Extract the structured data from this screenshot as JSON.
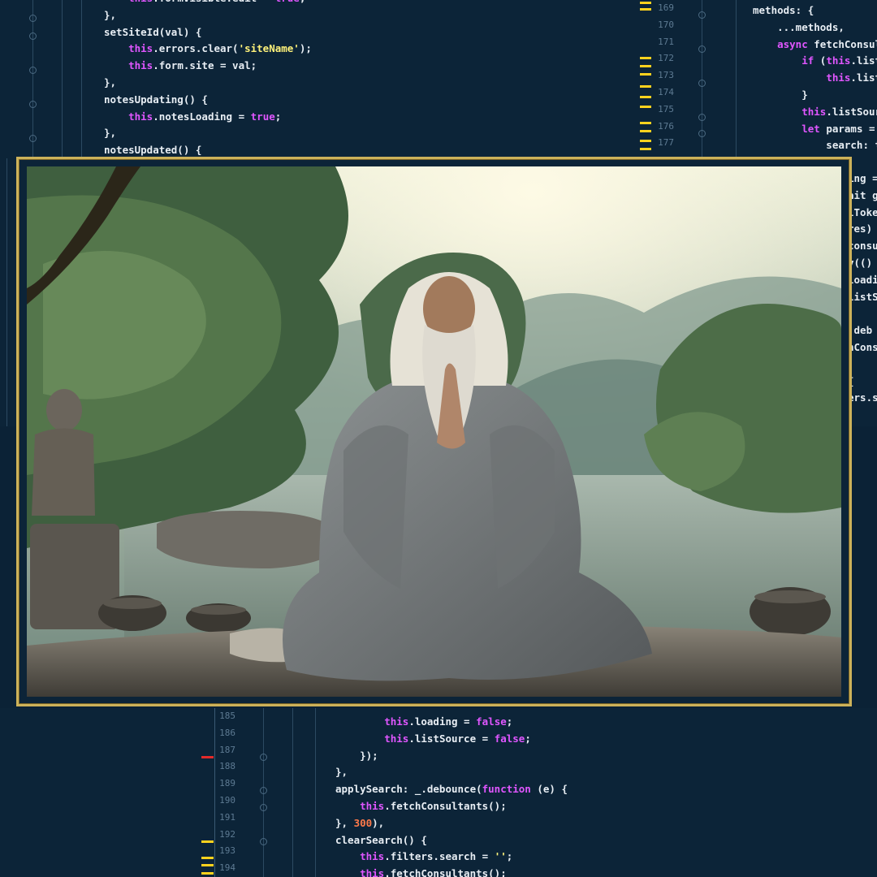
{
  "editor_top_left": {
    "lines": [
      [
        {
          "t": "    "
        },
        {
          "t": "this",
          "c": "kw"
        },
        {
          "t": ".formVisible.edit = "
        },
        {
          "t": "true",
          "c": "kw"
        },
        {
          "t": ";"
        }
      ],
      [
        {
          "t": "},"
        }
      ],
      [
        {
          "t": "setSiteId(val) {"
        }
      ],
      [
        {
          "t": "    "
        },
        {
          "t": "this",
          "c": "kw"
        },
        {
          "t": ".errors.clear("
        },
        {
          "t": "'siteName'",
          "c": "str"
        },
        {
          "t": ");"
        }
      ],
      [
        {
          "t": "    "
        },
        {
          "t": "this",
          "c": "kw"
        },
        {
          "t": ".form.site = val;"
        }
      ],
      [
        {
          "t": "},"
        }
      ],
      [
        {
          "t": "notesUpdating() {"
        }
      ],
      [
        {
          "t": "    "
        },
        {
          "t": "this",
          "c": "kw"
        },
        {
          "t": ".notesLoading = "
        },
        {
          "t": "true",
          "c": "kw"
        },
        {
          "t": ";"
        }
      ],
      [
        {
          "t": "},"
        }
      ],
      [
        {
          "t": "notesUpdated() {"
        }
      ]
    ]
  },
  "editor_top_right": {
    "line_numbers": [
      "169",
      "170",
      "171",
      "172",
      "173",
      "174",
      "175",
      "176",
      "177"
    ],
    "lines": [
      [
        {
          "t": "methods: {"
        }
      ],
      [
        {
          "t": "    ...methods,"
        }
      ],
      [
        {
          "t": "    "
        },
        {
          "t": "async",
          "c": "kw"
        },
        {
          "t": " fetchConsult"
        }
      ],
      [
        {
          "t": "        "
        },
        {
          "t": "if",
          "c": "kw"
        },
        {
          "t": " ("
        },
        {
          "t": "this",
          "c": "kw"
        },
        {
          "t": ".listS"
        }
      ],
      [
        {
          "t": "            "
        },
        {
          "t": "this",
          "c": "kw"
        },
        {
          "t": ".listS"
        }
      ],
      [
        {
          "t": "        }"
        }
      ],
      [
        {
          "t": "        "
        },
        {
          "t": "this",
          "c": "kw"
        },
        {
          "t": ".listSourc"
        }
      ],
      [
        {
          "t": "        "
        },
        {
          "t": "let",
          "c": "kw"
        },
        {
          "t": " params = {"
        }
      ],
      [
        {
          "t": "            search: th"
        }
      ]
    ]
  },
  "editor_right_strip": {
    "lines": [
      "ing =",
      "ait g",
      "lToke",
      "res)",
      "consu",
      "y(()",
      "loadi",
      "listS",
      "",
      ".deb",
      "nConsu",
      "",
      "{",
      "ers.s"
    ]
  },
  "editor_bottom": {
    "line_numbers": [
      "185",
      "186",
      "187",
      "188",
      "189",
      "190",
      "191",
      "192",
      "193",
      "194"
    ],
    "lines": [
      [
        {
          "t": "        "
        },
        {
          "t": "this",
          "c": "kw"
        },
        {
          "t": ".loading = "
        },
        {
          "t": "false",
          "c": "kw"
        },
        {
          "t": ";"
        }
      ],
      [
        {
          "t": "        "
        },
        {
          "t": "this",
          "c": "kw"
        },
        {
          "t": ".listSource = "
        },
        {
          "t": "false",
          "c": "kw"
        },
        {
          "t": ";"
        }
      ],
      [
        {
          "t": "    });"
        }
      ],
      [
        {
          "t": "},"
        }
      ],
      [
        {
          "t": "applySearch: _.debounce("
        },
        {
          "t": "function",
          "c": "kw"
        },
        {
          "t": " (e) {"
        }
      ],
      [
        {
          "t": "    "
        },
        {
          "t": "this",
          "c": "kw"
        },
        {
          "t": ".fetchConsultants();"
        }
      ],
      [
        {
          "t": "}, "
        },
        {
          "t": "300",
          "c": "numlit"
        },
        {
          "t": "),"
        }
      ],
      [
        {
          "t": "clearSearch() {"
        }
      ],
      [
        {
          "t": "    "
        },
        {
          "t": "this",
          "c": "kw"
        },
        {
          "t": ".filters.search = "
        },
        {
          "t": "''",
          "c": "str"
        },
        {
          "t": ";"
        }
      ],
      [
        {
          "t": "    "
        },
        {
          "t": "this",
          "c": "kw"
        },
        {
          "t": ".fetchConsultants();"
        }
      ]
    ]
  },
  "photo": {
    "subject": "elderly-monk-meditating-by-river"
  },
  "colors": {
    "background": "#0b2236",
    "frame_gold": "#cdb25a",
    "keyword": "#e056ff",
    "string": "#fff27a",
    "number": "#ff7a4a",
    "marker_yellow": "#ffd21e",
    "marker_red": "#e22a2a"
  }
}
